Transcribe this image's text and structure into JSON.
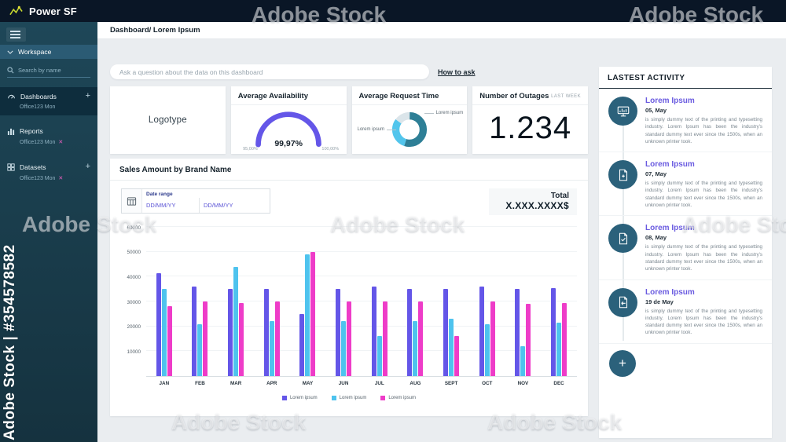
{
  "topbar": {
    "app_name": "Power SF"
  },
  "sidebar": {
    "workspace_label": "Workspace",
    "search_placeholder": "Search by name",
    "close_symbol": "✕",
    "sections": [
      {
        "label": "Dashboards",
        "sub_label": "Office123 Mon",
        "add": "+",
        "closable": false
      },
      {
        "label": "Reports",
        "sub_label": "Office123 Mon",
        "closable": true
      },
      {
        "label": "Datasets",
        "sub_label": "Office123 Mon",
        "add": "+",
        "closable": true
      }
    ]
  },
  "header": {
    "breadcrumb": "Dashboard/ Lorem Ipsum"
  },
  "ask": {
    "placeholder": "Ask a question about the data on this dashboard",
    "help_link": "How to ask"
  },
  "cards": {
    "logotype_label": "Logotype",
    "outages": {
      "title": "Number of Outages",
      "badge": "LAST WEEK",
      "value": "1.234"
    }
  },
  "sales": {
    "title": "Sales Amount by Brand Name",
    "date_range_label": "Date range",
    "date_from": "DD/MM/YY",
    "date_to": "DD/MM/YY",
    "total_label": "Total",
    "total_value": "X.XXX.XXXX$"
  },
  "chart_data": [
    {
      "type": "bar",
      "title": "Sales Amount by Brand Name",
      "categories": [
        "JAN",
        "FEB",
        "MAR",
        "APR",
        "MAY",
        "JUN",
        "JUL",
        "AUG",
        "SEPT",
        "OCT",
        "NOV",
        "DEC"
      ],
      "series": [
        {
          "name": "Lorem ipsum",
          "color": "#6456e8",
          "values": [
            41500,
            36000,
            35000,
            35000,
            25000,
            35000,
            36000,
            35000,
            35000,
            36000,
            35000,
            35500
          ]
        },
        {
          "name": "Lorem ipsum",
          "color": "#4ec3ee",
          "values": [
            35000,
            21000,
            44000,
            22000,
            49000,
            22000,
            16000,
            22000,
            23000,
            21000,
            12000,
            21500
          ]
        },
        {
          "name": "Lorem ipsum",
          "color": "#ee3cc8",
          "values": [
            28000,
            30000,
            29500,
            30000,
            50000,
            30000,
            30000,
            30000,
            16000,
            30000,
            29000,
            29500
          ]
        }
      ],
      "yticks": [
        10000,
        20000,
        30000,
        40000,
        50000,
        60000
      ],
      "ylim": [
        0,
        60000
      ],
      "xlabel": "",
      "ylabel": "",
      "grid": true,
      "legend_position": "bottom"
    },
    {
      "type": "gauge",
      "title": "Average Availability",
      "value": 99.97,
      "min": 95,
      "max": 100,
      "value_label": "99,97%",
      "min_label": "95,00%",
      "max_label": "100,00%",
      "color": "#6456e8",
      "track_color": "#e8ebee"
    },
    {
      "type": "pie",
      "title": "Average Request Time",
      "donut": true,
      "labels": [
        "Lorem ipsum",
        "Lorem ipsum",
        ""
      ],
      "values": [
        55,
        30,
        15
      ],
      "colors": [
        "#2e7f96",
        "#52c5ec",
        "#dbe5ea"
      ]
    }
  ],
  "activity": {
    "title": "LASTEST ACTIVITY",
    "add_label": "+",
    "items": [
      {
        "title": "Lorem Ipsum",
        "date": "05, May",
        "icon": "monitor-chart-icon",
        "text": "is simply dummy text of the printing and typesetting industry. Lorem Ipsum has been the industry's standard dummy text ever since the 1500s, when an unknown printer took."
      },
      {
        "title": "Lorem Ipsum",
        "date": "07, May",
        "icon": "file-plus-icon",
        "text": "is simply dummy text of the printing and typesetting industry. Lorem Ipsum has been the industry's standard dummy text ever since the 1500s, when an unknown printer took."
      },
      {
        "title": "Lorem Ipsum",
        "date": "08, May",
        "icon": "file-check-icon",
        "text": "is simply dummy text of the printing and typesetting industry. Lorem Ipsum has been the industry's standard dummy text ever since the 1500s, when an unknown printer took."
      },
      {
        "title": "Lorem Ipsum",
        "date": "19 de May",
        "icon": "file-return-icon",
        "text": "is simply dummy text of the printing and typesetting industry. Lorem Ipsum has been the industry's standard dummy text ever since the 1500s, when an unknown printer took."
      }
    ]
  },
  "watermark": {
    "side_text": "Adobe Stock | #354578582",
    "tile_text": "Adobe Stock"
  },
  "colors": {
    "topbar": "#0a1626",
    "sidebar": "#1e4758",
    "accent_purple": "#6456e8",
    "accent_cyan": "#4ec3ee",
    "accent_pink": "#ee3cc8",
    "circle_teal": "#2b617b"
  }
}
